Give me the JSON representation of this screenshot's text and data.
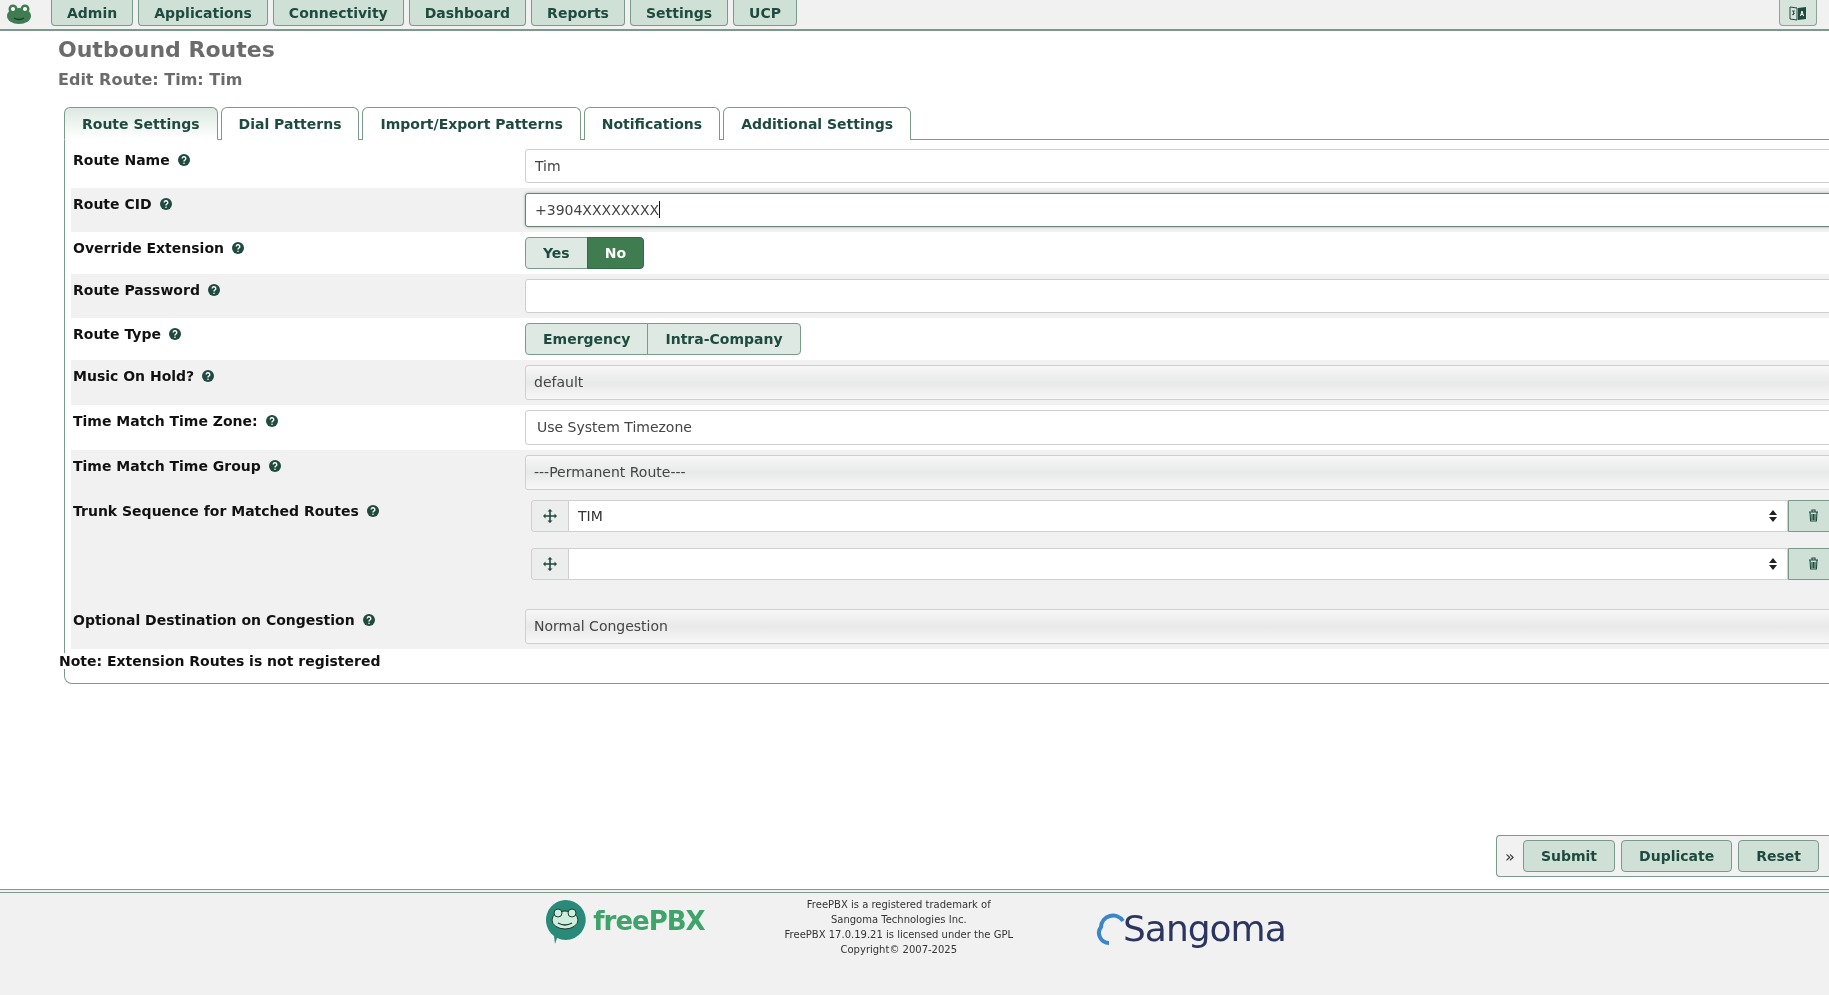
{
  "nav": [
    {
      "label": "Admin"
    },
    {
      "label": "Applications"
    },
    {
      "label": "Connectivity"
    },
    {
      "label": "Dashboard"
    },
    {
      "label": "Reports"
    },
    {
      "label": "Settings"
    },
    {
      "label": "UCP"
    }
  ],
  "title": "Outbound Routes",
  "subtitle": "Edit Route: Tim: Tim",
  "tabs": [
    {
      "label": "Route Settings",
      "selected": true
    },
    {
      "label": "Dial Patterns",
      "selected": false
    },
    {
      "label": "Import/Export Patterns",
      "selected": false
    },
    {
      "label": "Notifications",
      "selected": false
    },
    {
      "label": "Additional Settings",
      "selected": false
    }
  ],
  "fields": [
    {
      "kind": "text",
      "label": "Route Name",
      "value": "Tim",
      "focused": false
    },
    {
      "kind": "text",
      "label": "Route CID",
      "value": "+3904XXXXXXXX",
      "focused": true
    },
    {
      "kind": "toggle",
      "label": "Override Extension",
      "options": [
        {
          "label": "Yes",
          "selected": false
        },
        {
          "label": "No",
          "selected": true
        }
      ]
    },
    {
      "kind": "text",
      "label": "Route Password",
      "focused": false
    },
    {
      "kind": "toggle",
      "label": "Route Type",
      "options": [
        {
          "label": "Emergency",
          "selected": false
        },
        {
          "label": "Intra-Company",
          "selected": false
        }
      ]
    },
    {
      "kind": "select",
      "label": "Music On Hold?",
      "value": "default"
    },
    {
      "kind": "dropdown",
      "label": "Time Match Time Zone:",
      "value": "Use System Timezone"
    },
    {
      "kind": "select",
      "label": "Time Match Time Group",
      "value": "---Permanent Route---"
    },
    {
      "kind": "trunks",
      "label": "Trunk Sequence for Matched Routes",
      "trunks": [
        {
          "kind": "chosen",
          "value": "TIM"
        },
        {
          "kind": "blank"
        }
      ]
    },
    {
      "kind": "select",
      "label": "Optional Destination on Congestion",
      "value": "Normal Congestion"
    }
  ],
  "note": "Note: Extension Routes is not registered",
  "actions": {
    "toggle": "»",
    "buttons": [
      {
        "label": "Submit"
      },
      {
        "label": "Duplicate"
      },
      {
        "label": "Reset"
      }
    ]
  },
  "footer": {
    "brand": "freePBX",
    "lines": [
      "FreePBX is a registered trademark of",
      "Sangoma Technologies Inc.",
      "FreePBX 17.0.19.21 is licensed under the GPL",
      "Copyright© 2007-2025"
    ],
    "partner": "Sangoma"
  }
}
